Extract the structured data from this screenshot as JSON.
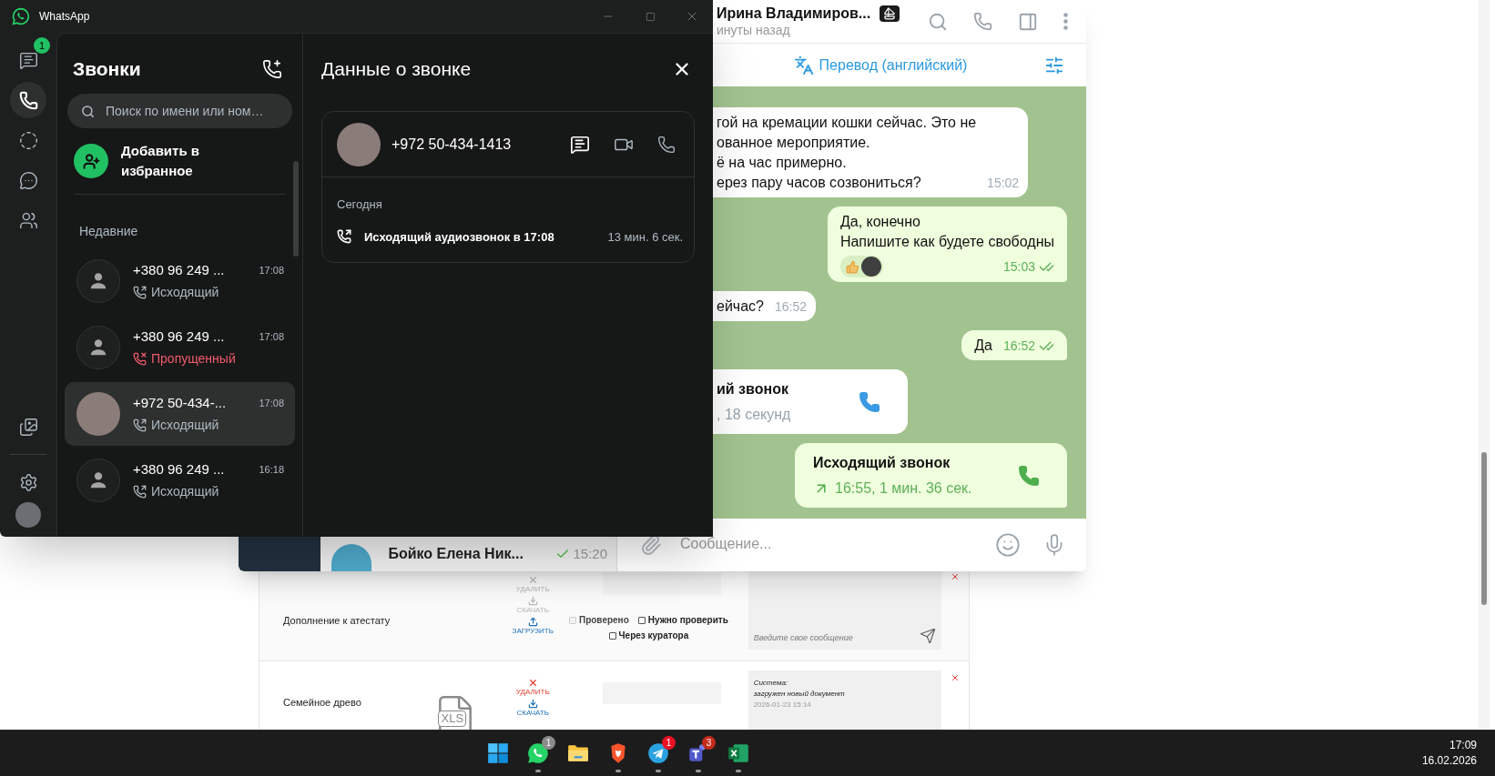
{
  "whatsapp": {
    "title": "WhatsApp",
    "rail": [
      {
        "selected": false,
        "badge": "1"
      },
      {
        "selected": true
      },
      {
        "selected": false
      },
      {
        "selected": false
      },
      {
        "selected": false
      }
    ],
    "calls_panel": {
      "title": "Звонки",
      "search": {
        "placeholder": "Поиск по имени или ном…"
      },
      "favorite": "Добавить в избранное",
      "section": "Недавние",
      "calls": [
        {
          "name": "+380 96 249 ...",
          "time": "17:08",
          "status": "Исходящий",
          "kind": "outgoing",
          "has_photo": false,
          "selected": false
        },
        {
          "name": "+380 96 249 ...",
          "time": "17:08",
          "status": "Пропущенный",
          "kind": "missed",
          "has_photo": false,
          "selected": false
        },
        {
          "name": "+972 50-434-...",
          "time": "17:08",
          "status": "Исходящий",
          "kind": "outgoing",
          "has_photo": true,
          "selected": true
        },
        {
          "name": "+380 96 249 ...",
          "time": "16:18",
          "status": "Исходящий",
          "kind": "outgoing",
          "has_photo": false,
          "selected": false
        }
      ]
    },
    "details": {
      "title": "Данные о звонке",
      "contact": "+972 50-434-1413",
      "day": "Сегодня",
      "entry": {
        "text": "Исходящий аудиозвонок в 17:08",
        "duration": "13 мин. 6 сек."
      }
    }
  },
  "telegram": {
    "chat_list_item": {
      "name": "Бойко Елена Ник...",
      "time": "15:20",
      "read": true
    },
    "header": {
      "name": "Ирина Владимиров...",
      "status": "инуты назад"
    },
    "translate": "Перевод (английский)",
    "messages": [
      {
        "kind": "text",
        "outgoing": false,
        "lines": [
          "гой на кремации кошки сейчас. Это не",
          "ованное мероприятие.",
          "ё на час примерно.",
          "ерез пару часов созвониться?"
        ],
        "time": "15:02"
      },
      {
        "kind": "text",
        "outgoing": true,
        "lines": [
          "Да, конечно",
          "Напишите как будете свободны"
        ],
        "time": "15:03",
        "read": true,
        "reacted": true
      },
      {
        "kind": "text",
        "outgoing": false,
        "lines": [
          "ейчас?"
        ],
        "time": "16:52"
      },
      {
        "kind": "text",
        "outgoing": true,
        "lines": [
          "Да"
        ],
        "time": "16:52",
        "read": true,
        "reacted": false
      },
      {
        "kind": "call",
        "outgoing": false,
        "title": "ий звонок",
        "detail": ", 18 секунд"
      },
      {
        "kind": "call",
        "outgoing": true,
        "title": "Исходящий звонок",
        "detail": "16:55, 1 мин. 36 сек."
      }
    ],
    "input": {
      "placeholder": "Сообщение..."
    }
  },
  "web_page": {
    "rows": [
      {
        "label": "Дополнение к атестату",
        "actions": [
          {
            "kind": "delete",
            "label": "УДАЛИТЬ",
            "enabled": false
          },
          {
            "kind": "download",
            "label": "СКАЧАТЬ",
            "enabled": false
          },
          {
            "kind": "upload",
            "label": "ЗАГРУЗИТЬ",
            "enabled": true
          }
        ],
        "checks": [
          {
            "label": "Проверено",
            "checked": false,
            "disabled": true
          },
          {
            "label": "Нужно проверить",
            "checked": false,
            "disabled": false
          },
          {
            "label": "Через куратора",
            "checked": false,
            "disabled": false
          }
        ],
        "comment": {
          "kind": "input",
          "placeholder": "Введите свое сообщение"
        }
      },
      {
        "label": "Семейное древо",
        "file": "XLS",
        "actions": [
          {
            "kind": "delete",
            "label": "УДАЛИТЬ",
            "enabled": true
          },
          {
            "kind": "download",
            "label": "СКАЧАТЬ",
            "enabled": true
          }
        ],
        "comment": {
          "kind": "note",
          "author": "Система:",
          "text": "загружен новый документ",
          "date": "2026-01-23 15:14"
        }
      }
    ]
  },
  "taskbar": {
    "apps": [
      {
        "running": false
      },
      {
        "badge": {
          "text": "1",
          "color": "#8a8a8a"
        },
        "running": true
      },
      {
        "running": false
      },
      {
        "running": true
      },
      {
        "badge": {
          "text": "1",
          "color": "#e81123"
        },
        "running": true
      },
      {
        "badge": {
          "text": "3",
          "color": "#c42b1c"
        },
        "running": true
      },
      {
        "running": true
      }
    ],
    "clock": {
      "time": "17:09",
      "date": "16.02.2026"
    }
  }
}
